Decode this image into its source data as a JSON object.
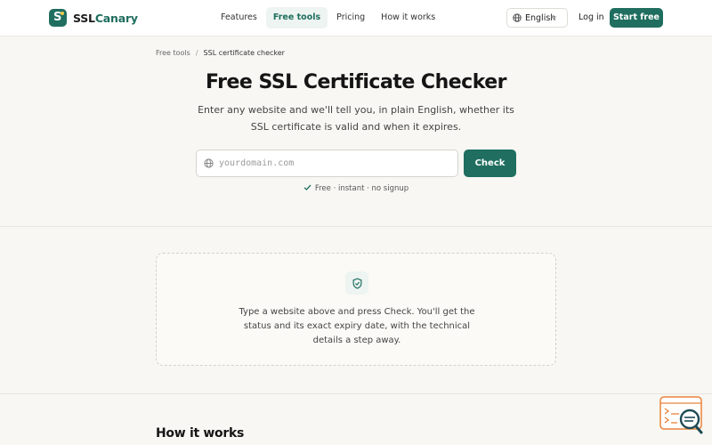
{
  "brand": {
    "name_part1": "SSL",
    "name_part2": "Canary",
    "logo_letter": "S"
  },
  "nav": {
    "links": [
      {
        "label": "Features",
        "active": false
      },
      {
        "label": "Free tools",
        "active": true
      },
      {
        "label": "Pricing",
        "active": false
      },
      {
        "label": "How it works",
        "active": false
      }
    ],
    "language": "English",
    "login": "Log in",
    "cta": "Start free"
  },
  "breadcrumb": {
    "parent": "Free tools",
    "separator": "/",
    "current": "SSL certificate checker"
  },
  "hero": {
    "title": "Free SSL Certificate Checker",
    "subtitle": "Enter any website and we'll tell you, in plain English, whether its SSL certificate is valid and when it expires.",
    "input_placeholder": "yourdomain.com",
    "input_value": "",
    "check_button": "Check",
    "note": "Free · instant · no signup"
  },
  "empty_state": {
    "message": "Type a website above and press Check. You'll get the status and its exact expiry date, with the technical details a step away."
  },
  "section": {
    "how_it_works_title": "How it works"
  },
  "colors": {
    "brand": "#1f6e5f",
    "background": "#f8f7f3",
    "accent_dot": "#f2c94c",
    "widget": "#e8833a"
  },
  "icons": {
    "input": "globe-icon",
    "language": "globe-icon",
    "note": "checkmark-icon",
    "card": "shield-check-icon",
    "widget": "search-chat-icon"
  }
}
